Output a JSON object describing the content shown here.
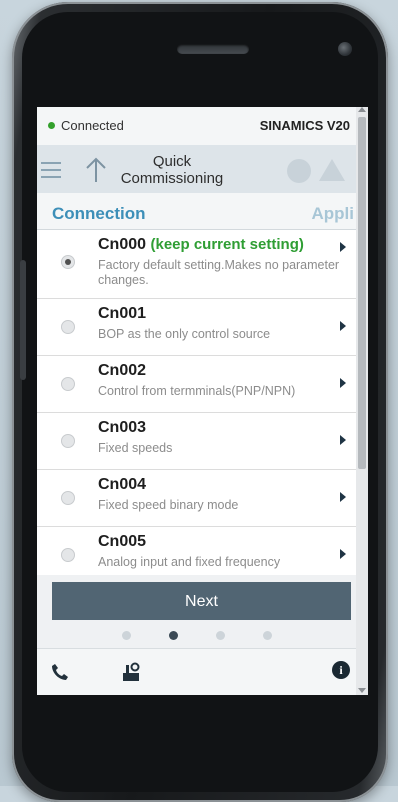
{
  "status": {
    "connection_text": "Connected",
    "device_name": "SINAMICS V20",
    "connection_color": "#33a02c"
  },
  "toolbar": {
    "title": "Quick Commissioning",
    "icons": [
      "menu-icon",
      "up-arrow-icon",
      "stop-icon",
      "warning-icon"
    ]
  },
  "tabs": {
    "active": "Connection",
    "next": "Appli"
  },
  "options": [
    {
      "code": "Cn000",
      "note": "(keep current setting)",
      "description": "Factory default setting.Makes no parameter changes.",
      "selected": true
    },
    {
      "code": "Cn001",
      "description": "BOP as the only control source",
      "selected": false
    },
    {
      "code": "Cn002",
      "description": "Control from termminals(PNP/NPN)",
      "selected": false
    },
    {
      "code": "Cn003",
      "description": "Fixed speeds",
      "selected": false
    },
    {
      "code": "Cn004",
      "description": "Fixed speed binary mode",
      "selected": false
    },
    {
      "code": "Cn005",
      "description": "Analog input and fixed frequency",
      "selected": false
    }
  ],
  "next_button": "Next",
  "pagination": {
    "total": 4,
    "current": 2
  },
  "bottom_bar": {
    "icons": [
      "phone-icon",
      "settings-icon",
      "info-icon"
    ],
    "info_glyph": "i"
  },
  "colors": {
    "accent": "#3d8fb8",
    "note_green": "#2f9e34",
    "button": "#516573"
  }
}
